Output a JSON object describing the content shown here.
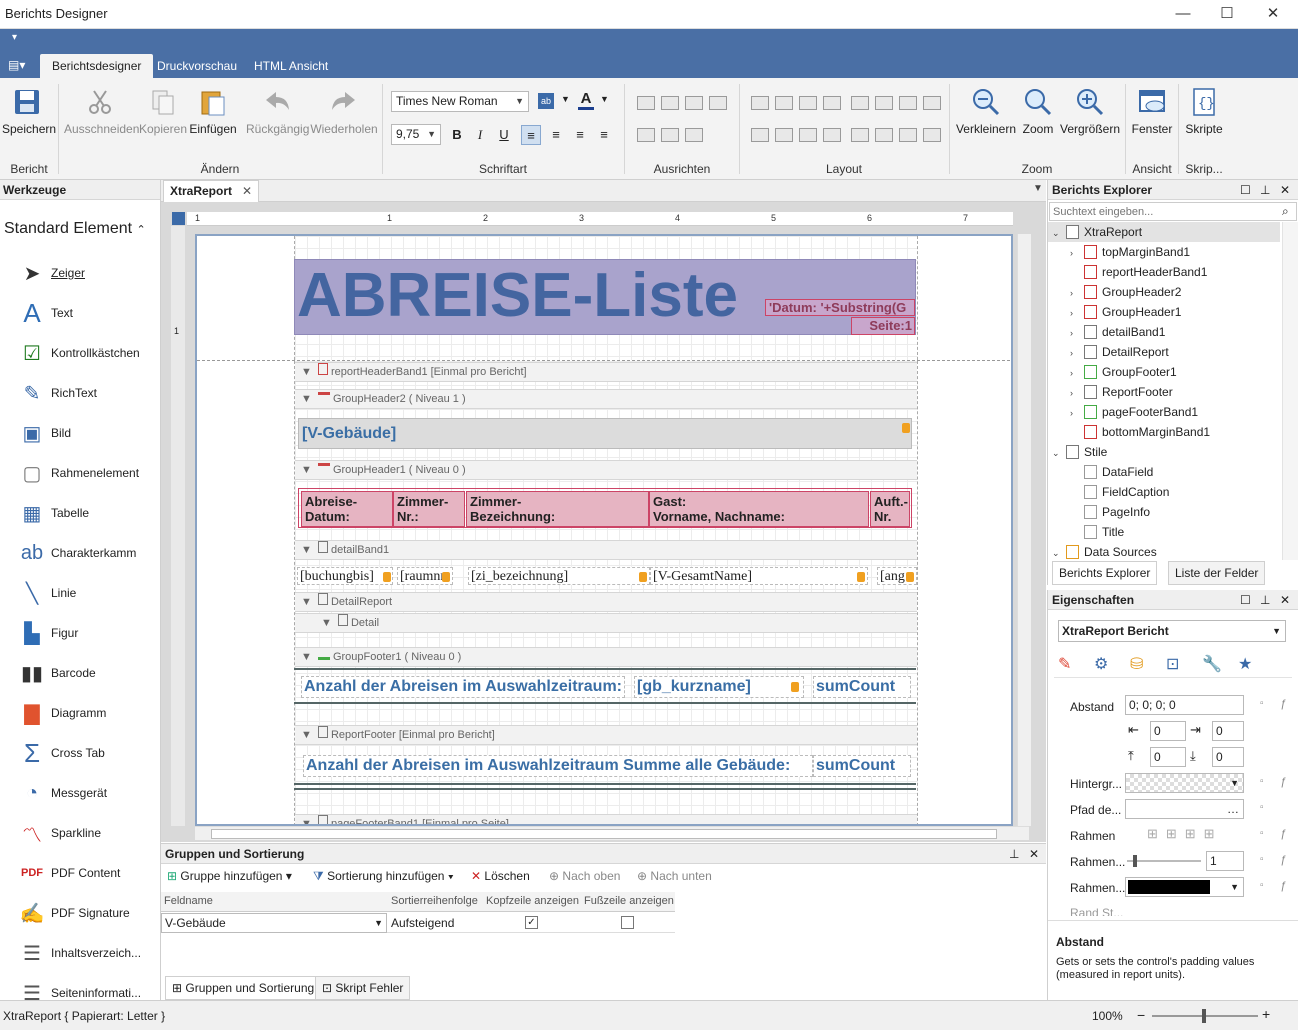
{
  "window": {
    "title": "Berichts Designer",
    "minimize": "—",
    "maximize": "☐",
    "close": "✕"
  },
  "ribbon": {
    "tabs": [
      "Berichtsdesigner",
      "Druckvorschau",
      "HTML Ansicht"
    ],
    "groups": {
      "bericht": {
        "label": "Bericht",
        "save": "Speichern"
      },
      "aendern": {
        "label": "Ändern",
        "cut": "Ausschneiden",
        "copy": "Kopieren",
        "paste": "Einfügen",
        "undo": "Rückgängig",
        "redo": "Wiederholen"
      },
      "schriftart": {
        "label": "Schriftart",
        "font": "Times New Roman",
        "size": "9,75",
        "bold": "B",
        "italic": "I",
        "underline": "U"
      },
      "ausrichten": {
        "label": "Ausrichten"
      },
      "layout": {
        "label": "Layout"
      },
      "zoom": {
        "label": "Zoom",
        "out": "Verkleinern",
        "zoom": "Zoom",
        "in": "Vergrößern"
      },
      "ansicht": {
        "label": "Ansicht",
        "window": "Fenster"
      },
      "skript": {
        "label": "Skrip...",
        "scripts": "Skripte"
      }
    }
  },
  "toolbox": {
    "title": "Werkzeuge",
    "section": "Standard Element",
    "items": [
      "Zeiger",
      "Text",
      "Kontrollkästchen",
      "RichText",
      "Bild",
      "Rahmenelement",
      "Tabelle",
      "Charakterkamm",
      "Linie",
      "Figur",
      "Barcode",
      "Diagramm",
      "Cross Tab",
      "Messgerät",
      "Sparkline",
      "PDF Content",
      "PDF Signature",
      "Inhaltsverzeich...",
      "Seiteninformati..."
    ]
  },
  "document": {
    "tab": "XtraReport",
    "ruler": [
      "1",
      "1",
      "2",
      "3",
      "4",
      "5",
      "6",
      "7"
    ],
    "title": "ABREISE-Liste",
    "date_expr": "'Datum: '+Substring(G",
    "page_expr": "Seite:1",
    "bands": {
      "reportHeader": "reportHeaderBand1 [Einmal pro Bericht]",
      "groupHeader2": "GroupHeader2 ( Niveau 1 )",
      "groupHeader1": "GroupHeader1 ( Niveau 0 )",
      "detail": "detailBand1",
      "detailReport": "DetailReport",
      "detailSub": "Detail",
      "groupFooter1": "GroupFooter1 ( Niveau 0 )",
      "reportFooter": "ReportFooter [Einmal pro Bericht]",
      "pageFooter": "pageFooterBand1 [Einmal pro Seite]"
    },
    "gebaeude_field": "[V-Gebäude]",
    "header_cells": [
      "Abreise-\nDatum:",
      "Zimmer-\nNr.:",
      "Zimmer-\nBezeichnung:",
      "Gast:\nVorname, Nachname:",
      "Auft.-\nNr."
    ],
    "detail_fields": [
      "[buchungbis]",
      "[raumnr",
      "[zi_bezeichnung]",
      "[V-GesamtName]",
      "[ang"
    ],
    "footer1_label": "Anzahl der Abreisen im Auswahlzeitraum:",
    "footer1_field": "[gb_kurzname]",
    "sum_field": "sumCount",
    "footer2_label": "Anzahl der Abreisen im Auswahlzeitraum Summe alle Gebäude:"
  },
  "explorer": {
    "title": "Berichts Explorer",
    "search_placeholder": "Suchtext eingeben...",
    "root": "XtraReport",
    "nodes": [
      "topMarginBand1",
      "reportHeaderBand1",
      "GroupHeader2",
      "GroupHeader1",
      "detailBand1",
      "DetailReport",
      "GroupFooter1",
      "ReportFooter",
      "pageFooterBand1",
      "bottomMarginBand1"
    ],
    "styles_label": "Stile",
    "styles": [
      "DataField",
      "FieldCaption",
      "PageInfo",
      "Title"
    ],
    "datasources": "Data Sources",
    "tab_explorer": "Berichts Explorer",
    "tab_fields": "Liste der Felder"
  },
  "properties": {
    "title": "Eigenschaften",
    "selector": "XtraReport  Bericht",
    "abstand_label": "Abstand",
    "abstand_value": "0; 0; 0; 0",
    "pad_left": "0",
    "pad_right": "0",
    "pad_top": "0",
    "pad_bottom": "0",
    "hintergrund": "Hintergr...",
    "pfad": "Pfad de...",
    "rahmen": "Rahmen",
    "rahmen2": "Rahmen...",
    "rahmen2_value": "1",
    "rahmen3": "Rahmen...",
    "randst": "Rand St...",
    "desc_title": "Abstand",
    "desc_text": "Gets or sets the control's padding values (measured in report units)."
  },
  "groups": {
    "title": "Gruppen und Sortierung",
    "add_group": "Gruppe hinzufügen",
    "add_sort": "Sortierung hinzufügen",
    "delete": "Löschen",
    "up": "Nach oben",
    "down": "Nach unten",
    "columns": [
      "Feldname",
      "Sortierreihenfolge",
      "Kopfzeile anzeigen",
      "Fußzeile anzeigen"
    ],
    "row": {
      "field": "V-Gebäude",
      "order": "Aufsteigend",
      "header": true,
      "footer": false
    },
    "tab1": "Gruppen und Sortierung",
    "tab2": "Skript Fehler"
  },
  "status": {
    "left": "XtraReport { Papierart: Letter }",
    "zoom": "100%"
  }
}
